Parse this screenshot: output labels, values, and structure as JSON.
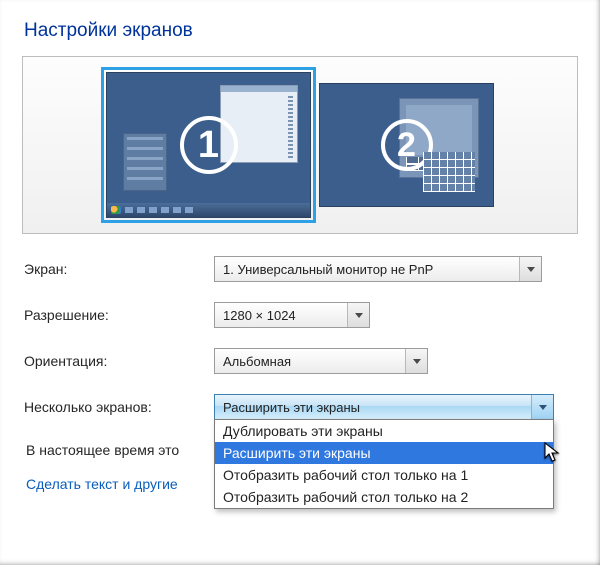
{
  "title": "Настройки экранов",
  "monitors": {
    "m1_number": "1",
    "m2_number": "2"
  },
  "rows": {
    "screen": {
      "label": "Экран:",
      "value": "1. Универсальный монитор не PnP"
    },
    "resolution": {
      "label": "Разрешение:",
      "value": "1280 × 1024"
    },
    "orientation": {
      "label": "Ориентация:",
      "value": "Альбомная"
    },
    "multi": {
      "label": "Несколько экранов:",
      "value": "Расширить эти экраны",
      "options": {
        "o0": "Дублировать эти экраны",
        "o1": "Расширить эти экраны",
        "o2": "Отобразить рабочий стол только на 1",
        "o3": "Отобразить рабочий стол только на 2"
      }
    }
  },
  "status_line": "В настоящее время это",
  "link_text": "Сделать текст и другие"
}
